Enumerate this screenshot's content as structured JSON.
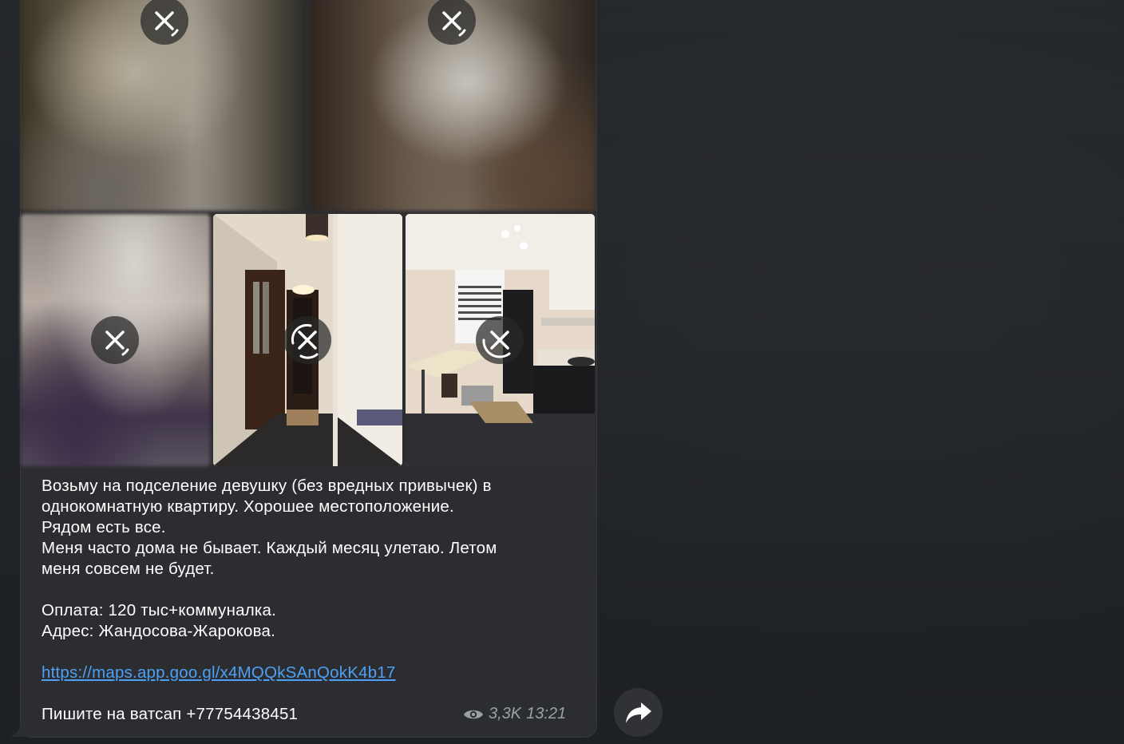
{
  "message": {
    "caption_lines": [
      "Возьму на подселение девушку (без вредных привычек) в",
      "однокомнатную квартиру. Хорошее местоположение.",
      "Рядом есть все.",
      "Меня часто дома не бывает. Каждый месяц улетаю. Летом",
      "меня совсем не будет."
    ],
    "payment": "Оплата: 120 тыс+коммуналка.",
    "address": "Адрес: Жандосова-Жарокова.",
    "link": "https://maps.app.goo.gl/x4MQQkSAnQokK4b17",
    "contact": "Пишите на ватсап +77754438451",
    "views": "3,3K",
    "time": "13:21"
  },
  "photos": [
    {
      "name": "photo-1",
      "state": "blurred",
      "icon": "cancel-download-icon"
    },
    {
      "name": "photo-2",
      "state": "blurred",
      "icon": "cancel-download-icon"
    },
    {
      "name": "photo-3",
      "state": "blurred",
      "icon": "cancel-download-icon"
    },
    {
      "name": "photo-4-hallway",
      "state": "loaded",
      "icon": "cancel-download-icon"
    },
    {
      "name": "photo-5-kitchen",
      "state": "loaded",
      "icon": "cancel-download-icon"
    }
  ],
  "icons": {
    "views": "eye-icon",
    "forward": "share-arrow-icon"
  },
  "colors": {
    "background": "#1f2226",
    "bubble": "#2c2d31",
    "link": "#4ea0f5",
    "meta": "#9aa0a6"
  }
}
